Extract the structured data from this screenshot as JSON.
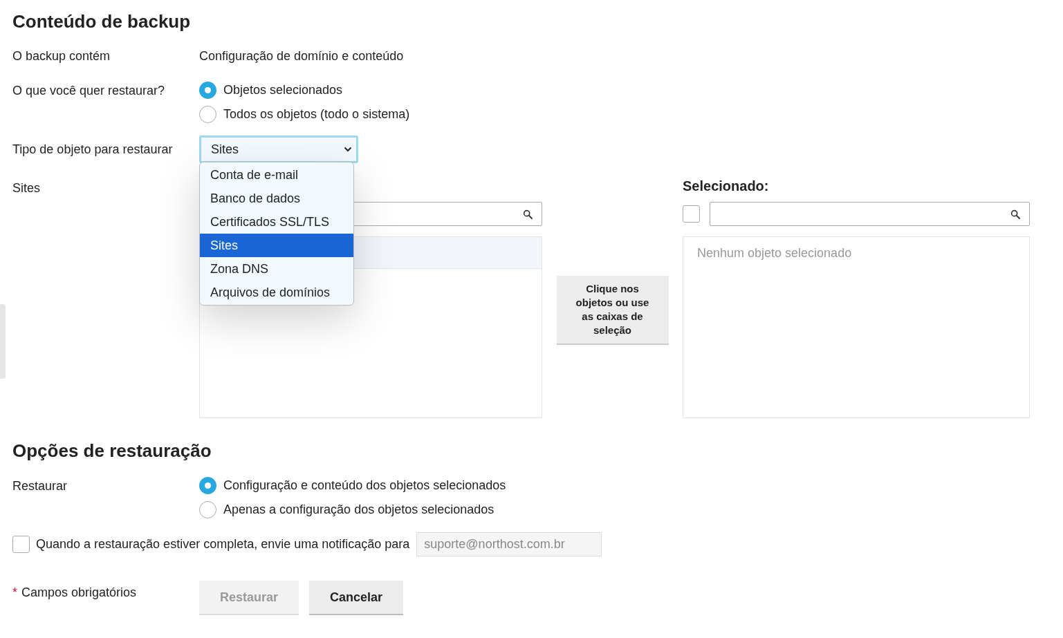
{
  "backup_content": {
    "title": "Conteúdo de backup",
    "contains_label": "O backup contém",
    "contains_value": "Configuração de domínio e conteúdo"
  },
  "restore_what": {
    "label": "O que você quer restaurar?",
    "options": [
      {
        "label": "Objetos selecionados",
        "selected": true
      },
      {
        "label": "Todos os objetos (todo o sistema)",
        "selected": false
      }
    ]
  },
  "object_type": {
    "label": "Tipo de objeto para restaurar",
    "value": "Sites",
    "expanded": true,
    "options": [
      {
        "label": "Conta de e-mail",
        "selected": false
      },
      {
        "label": "Banco de dados",
        "selected": false
      },
      {
        "label": "Certificados SSL/TLS",
        "selected": false
      },
      {
        "label": "Sites",
        "selected": true
      },
      {
        "label": "Zona DNS",
        "selected": false
      },
      {
        "label": "Arquivos de domínios",
        "selected": false
      }
    ]
  },
  "picker": {
    "label": "Sites",
    "hint_button": "Clique nos objetos ou use as caixas de seleção",
    "selected_title": "Selecionado:",
    "select_all_checked": false,
    "empty_text": "Nenhum objeto selecionado"
  },
  "restore_options": {
    "title": "Opções de restauração",
    "label": "Restaurar",
    "options": [
      {
        "label": "Configuração e conteúdo dos objetos selecionados",
        "selected": true
      },
      {
        "label": "Apenas a configuração dos objetos selecionados",
        "selected": false
      }
    ]
  },
  "notify": {
    "checked": false,
    "label": "Quando a restauração estiver completa, envie uma notificação para",
    "email": "suporte@northost.com.br",
    "disabled": true
  },
  "footer": {
    "required_mark": "*",
    "required_label": "Campos obrigatórios",
    "buttons": [
      {
        "label": "Restaurar",
        "disabled": true
      },
      {
        "label": "Cancelar",
        "disabled": false
      }
    ]
  }
}
